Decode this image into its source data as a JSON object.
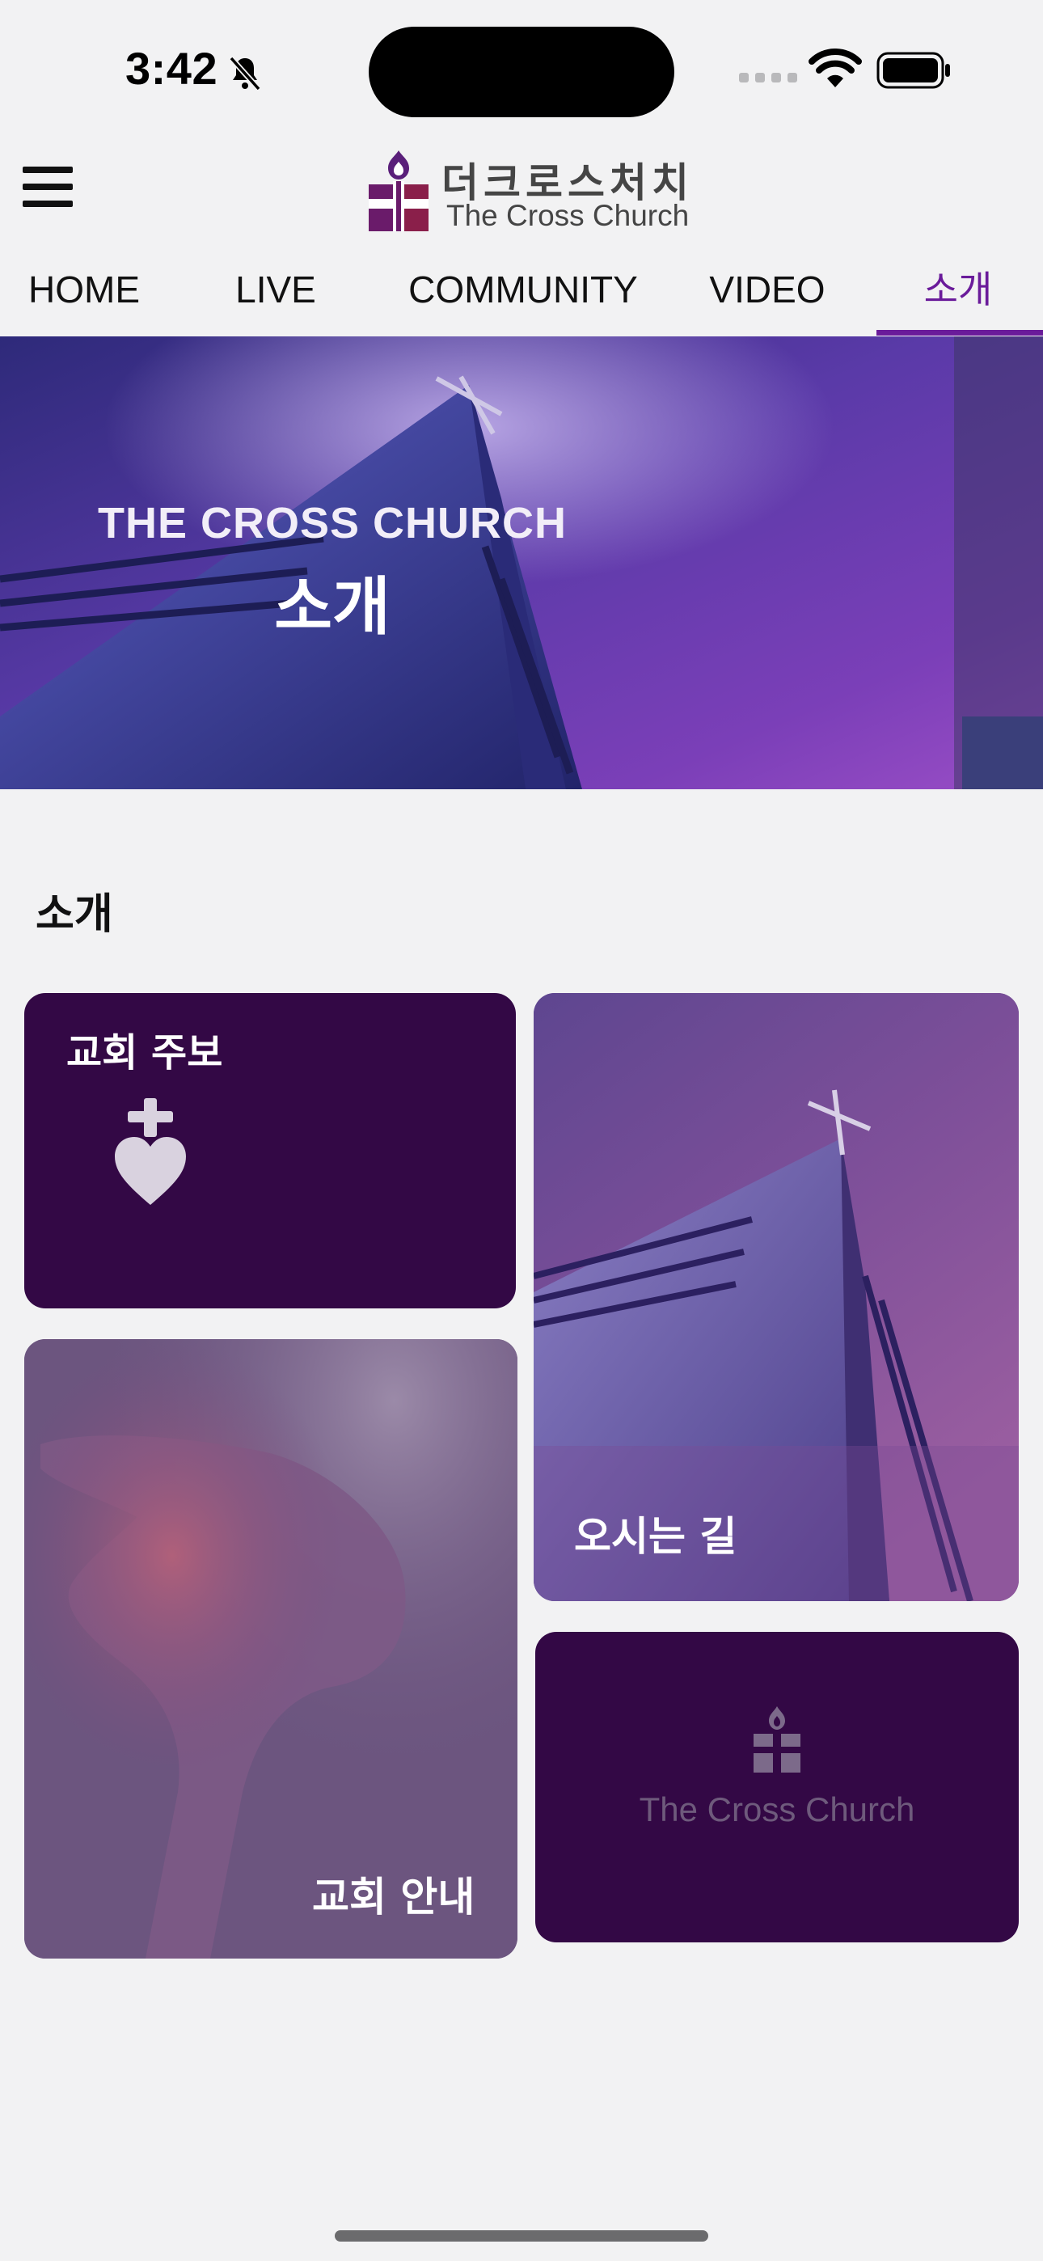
{
  "status_bar": {
    "time": "3:42"
  },
  "header": {
    "logo_korean": "더크로스처치",
    "logo_english": "The Cross Church"
  },
  "tabs": [
    {
      "label": "HOME"
    },
    {
      "label": "LIVE"
    },
    {
      "label": "COMMUNITY"
    },
    {
      "label": "VIDEO"
    },
    {
      "label": "소개",
      "active": true
    }
  ],
  "hero": {
    "subtitle": "THE CROSS CHURCH",
    "title": "소개"
  },
  "section": {
    "title": "소개"
  },
  "cards": {
    "bulletin": {
      "label": "교회 주보"
    },
    "directions": {
      "label": "오시는 길"
    },
    "guide": {
      "label": "교회 안내"
    },
    "brand": {
      "label": "The Cross Church"
    }
  },
  "colors": {
    "accent": "#6a1b9a",
    "card_dark": "#330845",
    "background": "#f2f2f3"
  },
  "icons": [
    "bell-slash-icon",
    "wifi-icon",
    "battery-icon",
    "menu-icon",
    "cross-heart-icon",
    "church-logo-icon"
  ]
}
